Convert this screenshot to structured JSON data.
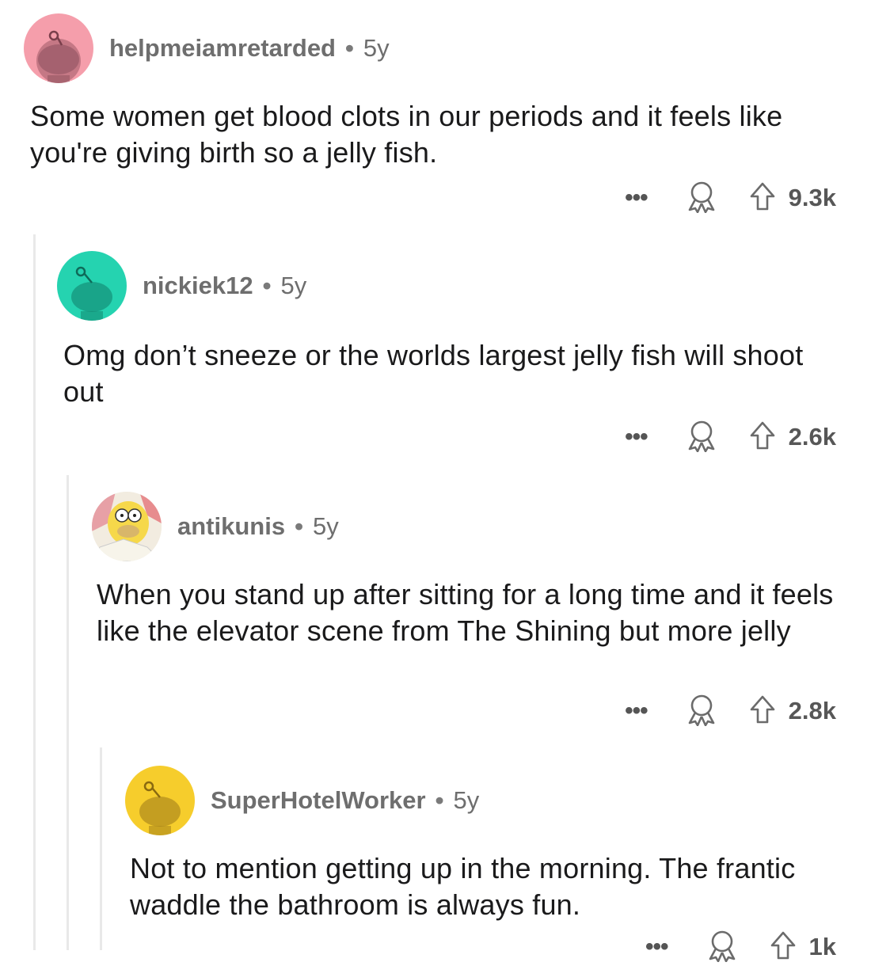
{
  "comments": [
    {
      "username": "helpmeiamretarded",
      "separator": "•",
      "age": "5y",
      "body": "Some women get blood clots in our periods and it feels like you're giving birth so a jelly fish.",
      "more": "•••",
      "score": "9.3k",
      "avatar_bg": "#f59eab",
      "avatar_icon": "snoo-avatar-icon"
    },
    {
      "username": "nickiek12",
      "separator": "•",
      "age": "5y",
      "body": "Omg don’t sneeze or the worlds largest jelly fish will shoot out",
      "more": "•••",
      "score": "2.6k",
      "avatar_bg": "#25d3b0",
      "avatar_icon": "snoo-avatar-icon"
    },
    {
      "username": "antikunis",
      "separator": "•",
      "age": "5y",
      "body": "When you stand up after sitting for a long time and it feels like the elevator scene from The Shining but more jelly",
      "more": "•••",
      "score": "2.8k",
      "avatar_bg": "#f5d94a",
      "avatar_icon": "cartoon-character-avatar"
    },
    {
      "username": "SuperHotelWorker",
      "separator": "•",
      "age": "5y",
      "body": "Not to mention getting up in the morning. The frantic waddle the bathroom is always fun.",
      "more": "•••",
      "score": "1k",
      "avatar_bg": "#f6cd2c",
      "avatar_icon": "snoo-avatar-icon"
    }
  ],
  "colors": {
    "thread_line": "#e9e9e9",
    "meta_text": "#6e6e6e",
    "body_text": "#1a1a1b"
  }
}
